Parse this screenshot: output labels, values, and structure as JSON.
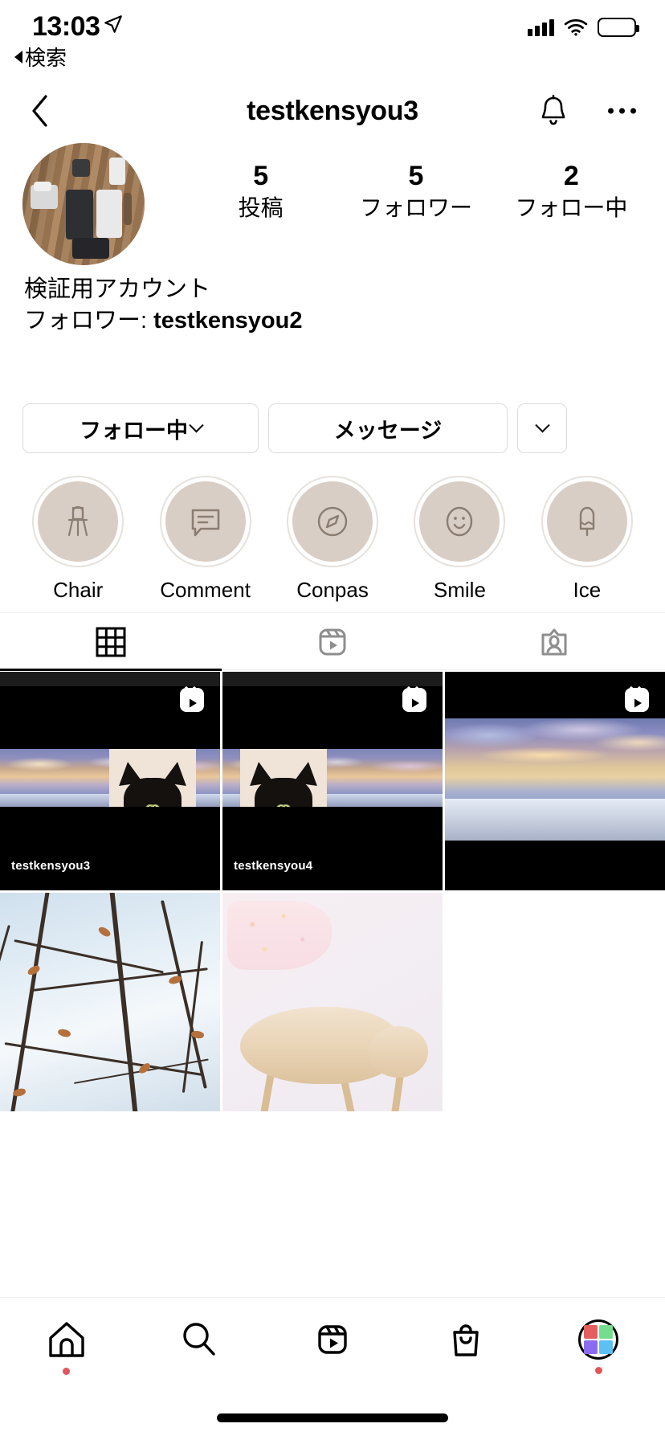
{
  "status_bar": {
    "time": "13:03",
    "back_label": "検索",
    "location_icon": "location-arrow-icon",
    "signal_icon": "cellular-signal-icon",
    "wifi_icon": "wifi-icon",
    "battery_icon": "battery-icon"
  },
  "nav": {
    "back_icon": "back-chevron-icon",
    "title": "testkensyou3",
    "bell_icon": "notification-bell-icon",
    "more_icon": "more-options-icon"
  },
  "profile": {
    "avatar_alt": "profile-photo-desk-with-phones",
    "stats": [
      {
        "number": "5",
        "label": "投稿"
      },
      {
        "number": "5",
        "label": "フォロワー"
      },
      {
        "number": "2",
        "label": "フォロー中"
      }
    ],
    "display_name": "検証用アカウント",
    "mutual_prefix": "フォロワー: ",
    "mutual_user": "testkensyou2"
  },
  "actions": {
    "follow_label": "フォロー中",
    "message_label": "メッセージ",
    "more_label": ""
  },
  "highlights": [
    {
      "label": "Chair",
      "icon": "chair-icon"
    },
    {
      "label": "Comment",
      "icon": "comment-icon"
    },
    {
      "label": "Conpas",
      "icon": "compass-icon"
    },
    {
      "label": "Smile",
      "icon": "smile-icon"
    },
    {
      "label": "Ice",
      "icon": "ice-cream-icon"
    }
  ],
  "tabs": [
    {
      "name": "grid-tab",
      "icon": "grid-icon",
      "active": true
    },
    {
      "name": "reels-tab",
      "icon": "reels-icon",
      "active": false
    },
    {
      "name": "tagged-tab",
      "icon": "tagged-person-icon",
      "active": false
    }
  ],
  "posts": [
    {
      "type": "reel",
      "overlay_user": "testkensyou3",
      "content": "sunset-sky-and-black-cat"
    },
    {
      "type": "reel",
      "overlay_user": "testkensyou4",
      "content": "black-cat-and-sunset-sky"
    },
    {
      "type": "reel",
      "overlay_user": "",
      "content": "sunset-ocean-sky"
    },
    {
      "type": "photo",
      "overlay_user": "",
      "content": "winter-branches-sky"
    },
    {
      "type": "photo",
      "overlay_user": "",
      "content": "sleeping-cream-cat"
    }
  ],
  "tabbar": [
    {
      "name": "home-tab",
      "icon": "home-icon",
      "badge": true
    },
    {
      "name": "search-tab",
      "icon": "search-icon",
      "badge": false
    },
    {
      "name": "reels-tab",
      "icon": "reels-icon",
      "badge": false
    },
    {
      "name": "shop-tab",
      "icon": "shopping-bag-icon",
      "badge": false
    },
    {
      "name": "profile-tab",
      "icon": "profile-avatar-icon",
      "badge": true
    }
  ],
  "colors": {
    "highlight_fill": "#d9cec5",
    "highlight_ring": "#e6e1dc",
    "badge_red": "#e2565a",
    "border_gray": "#dbdbdb",
    "inactive_gray": "#8e8e8e",
    "avatar_red": "#e4605f",
    "avatar_green": "#77dd8e",
    "avatar_purple": "#8b6cf0",
    "avatar_blue": "#5cc0f5"
  }
}
